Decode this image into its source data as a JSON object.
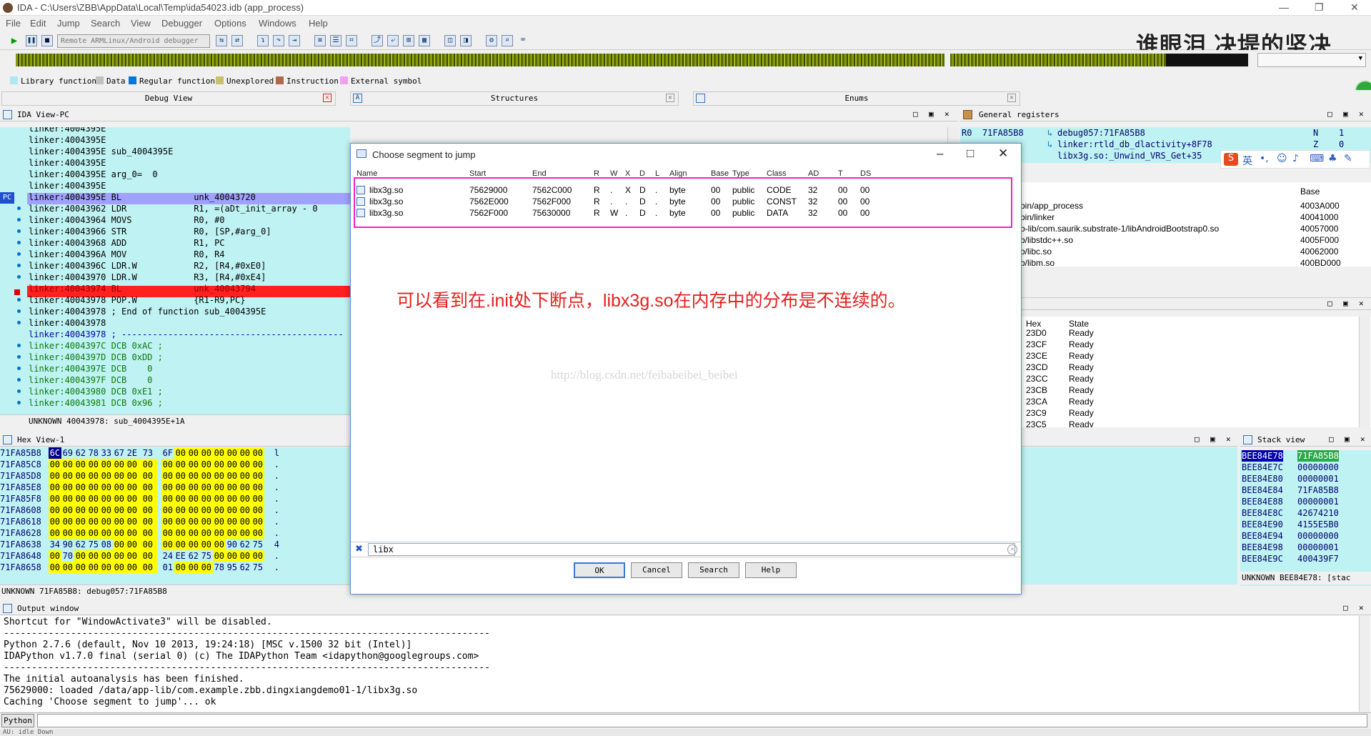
{
  "window": {
    "title": "IDA - C:\\Users\\ZBB\\AppData\\Local\\Temp\\ida54023.idb (app_process)"
  },
  "menu": [
    "File",
    "Edit",
    "Jump",
    "Search",
    "View",
    "Debugger",
    "Options",
    "Windows",
    "Help"
  ],
  "toolbar": {
    "debugger": "Remote ARMLinux/Android debugger"
  },
  "overlay_caption": "谁眼泪 决堤的坚决",
  "legend": [
    {
      "label": "Library function",
      "color": "#aee8f0"
    },
    {
      "label": "Data",
      "color": "#c0c0c0"
    },
    {
      "label": "Regular function",
      "color": "#0078d7"
    },
    {
      "label": "Unexplored",
      "color": "#c8c070"
    },
    {
      "label": "Instruction",
      "color": "#b06848"
    },
    {
      "label": "External symbol",
      "color": "#f0a0f0"
    }
  ],
  "tabs": {
    "debug_view": "Debug View",
    "structures": "Structures",
    "enums": "Enums"
  },
  "ida_view": {
    "title": "IDA View-PC",
    "lines": [
      "linker:4004395E",
      "linker:4004395E",
      "linker:4004395E sub_4004395E",
      "linker:4004395E",
      "linker:4004395E arg_0=  0",
      "linker:4004395E",
      "linker:4004395E BL              unk_40043720",
      "linker:40043962 LDR             R1, =(aDt_init_array - 0",
      "linker:40043964 MOVS            R0, #0",
      "linker:40043966 STR             R0, [SP,#arg_0]",
      "linker:40043968 ADD             R1, PC",
      "linker:4004396A MOV             R0, R4",
      "linker:4004396C LDR.W           R2, [R4,#0xE0]",
      "linker:40043970 LDR.W           R3, [R4,#0xE4]",
      "linker:40043974 BL              unk_40043794",
      "linker:40043978 POP.W           {R1-R9,PC}",
      "linker:40043978 ; End of function sub_4004395E",
      "linker:40043978",
      "linker:40043978 ; -------------------------------------------",
      "linker:4004397C DCB 0xAC ;",
      "linker:4004397D DCB 0xDD ;",
      "linker:4004397E DCB    0",
      "linker:4004397F DCB    0",
      "linker:40043980 DCB 0xE1 ;",
      "linker:40043981 DCB 0x96 ;"
    ],
    "pc_label": "PC",
    "status": "UNKNOWN 40043978: sub_4004395E+1A"
  },
  "hex_view": {
    "title": "Hex View-1",
    "rows": [
      {
        "addr": "71FA85B8",
        "bytes": [
          "6C",
          "69",
          "62",
          "78",
          "33",
          "67",
          "2E",
          "73",
          "6F",
          "00",
          "00",
          "00",
          "00",
          "00",
          "00",
          "00"
        ],
        "ascii": "l"
      },
      {
        "addr": "71FA85C8",
        "bytes": [
          "00",
          "00",
          "00",
          "00",
          "00",
          "00",
          "00",
          "00",
          "00",
          "00",
          "00",
          "00",
          "00",
          "00",
          "00",
          "00"
        ],
        "ascii": "."
      },
      {
        "addr": "71FA85D8",
        "bytes": [
          "00",
          "00",
          "00",
          "00",
          "00",
          "00",
          "00",
          "00",
          "00",
          "00",
          "00",
          "00",
          "00",
          "00",
          "00",
          "00"
        ],
        "ascii": "."
      },
      {
        "addr": "71FA85E8",
        "bytes": [
          "00",
          "00",
          "00",
          "00",
          "00",
          "00",
          "00",
          "00",
          "00",
          "00",
          "00",
          "00",
          "00",
          "00",
          "00",
          "00"
        ],
        "ascii": "."
      },
      {
        "addr": "71FA85F8",
        "bytes": [
          "00",
          "00",
          "00",
          "00",
          "00",
          "00",
          "00",
          "00",
          "00",
          "00",
          "00",
          "00",
          "00",
          "00",
          "00",
          "00"
        ],
        "ascii": "."
      },
      {
        "addr": "71FA8608",
        "bytes": [
          "00",
          "00",
          "00",
          "00",
          "00",
          "00",
          "00",
          "00",
          "00",
          "00",
          "00",
          "00",
          "00",
          "00",
          "00",
          "00"
        ],
        "ascii": "."
      },
      {
        "addr": "71FA8618",
        "bytes": [
          "00",
          "00",
          "00",
          "00",
          "00",
          "00",
          "00",
          "00",
          "00",
          "00",
          "00",
          "00",
          "00",
          "00",
          "00",
          "00"
        ],
        "ascii": "."
      },
      {
        "addr": "71FA8628",
        "bytes": [
          "00",
          "00",
          "00",
          "00",
          "00",
          "00",
          "00",
          "00",
          "00",
          "00",
          "00",
          "00",
          "00",
          "00",
          "00",
          "00"
        ],
        "ascii": "."
      },
      {
        "addr": "71FA8638",
        "bytes": [
          "34",
          "90",
          "62",
          "75",
          "08",
          "00",
          "00",
          "00",
          "00",
          "00",
          "00",
          "00",
          "00",
          "90",
          "62",
          "75"
        ],
        "ascii": "4"
      },
      {
        "addr": "71FA8648",
        "bytes": [
          "00",
          "70",
          "00",
          "00",
          "00",
          "00",
          "00",
          "00",
          "24",
          "EE",
          "62",
          "75",
          "00",
          "00",
          "00",
          "00"
        ],
        "ascii": "."
      },
      {
        "addr": "71FA8658",
        "bytes": [
          "00",
          "00",
          "00",
          "00",
          "00",
          "00",
          "00",
          "00",
          "01",
          "00",
          "00",
          "00",
          "78",
          "95",
          "62",
          "75"
        ],
        "ascii": "."
      }
    ],
    "status": "UNKNOWN 71FA85B8: debug057:71FA85B8"
  },
  "registers": {
    "title": "General registers",
    "r0": "R0  71FA85B8",
    "r0_ref": "debug057:71FA85B8",
    "r1_ref": "linker:rtld_db_dlactivity+8F78",
    "r2_ref": "libx3g.so:_Unwind_VRS_Get+35",
    "flags": [
      {
        "name": "N",
        "value": "1"
      },
      {
        "name": "Z",
        "value": "0"
      }
    ]
  },
  "modules": {
    "base_label": "Base",
    "rows": [
      {
        "path": "bin/app_process",
        "base": "4003A000"
      },
      {
        "path": "bin/linker",
        "base": "40041000"
      },
      {
        "path": "b-lib/com.saurik.substrate-1/libAndroidBootstrap0.so",
        "base": "40057000"
      },
      {
        "path": "b/libstdc++.so",
        "base": "4005F000"
      },
      {
        "path": "b/libc.so",
        "base": "40062000"
      },
      {
        "path": "b/libm.so",
        "base": "400BD000"
      }
    ]
  },
  "threads": {
    "hex_label": "Hex",
    "state_label": "State",
    "rows": [
      {
        "hex": "23D0",
        "state": "Ready"
      },
      {
        "hex": "23CF",
        "state": "Ready"
      },
      {
        "hex": "23CE",
        "state": "Ready"
      },
      {
        "hex": "23CD",
        "state": "Ready"
      },
      {
        "hex": "23CC",
        "state": "Ready"
      },
      {
        "hex": "23CB",
        "state": "Ready"
      },
      {
        "hex": "23CA",
        "state": "Ready"
      },
      {
        "hex": "23C9",
        "state": "Ready"
      },
      {
        "hex": "23C5",
        "state": "Ready"
      }
    ]
  },
  "stack_view": {
    "title": "Stack view",
    "rows": [
      {
        "addr": "BEE84E78",
        "val": "71FA85B8"
      },
      {
        "addr": "BEE84E7C",
        "val": "00000000"
      },
      {
        "addr": "BEE84E80",
        "val": "00000001"
      },
      {
        "addr": "BEE84E84",
        "val": "71FA85B8"
      },
      {
        "addr": "BEE84E88",
        "val": "00000001"
      },
      {
        "addr": "BEE84E8C",
        "val": "42674210"
      },
      {
        "addr": "BEE84E90",
        "val": "4155E5B0"
      },
      {
        "addr": "BEE84E94",
        "val": "00000000"
      },
      {
        "addr": "BEE84E98",
        "val": "00000001"
      },
      {
        "addr": "BEE84E9C",
        "val": "400439F7"
      }
    ],
    "status": "UNKNOWN BEE84E78: [stac"
  },
  "output": {
    "title": "Output window",
    "lines": [
      "Shortcut for \"WindowActivate3\" will be disabled.",
      "---------------------------------------------------------------------------------------",
      "Python 2.7.6 (default, Nov 10 2013, 19:24:18) [MSC v.1500 32 bit (Intel)]",
      "IDAPython v1.7.0 final (serial 0) (c) The IDAPython Team <idapython@googlegroups.com>",
      "---------------------------------------------------------------------------------------",
      "The initial autoanalysis has been finished.",
      "75629000: loaded /data/app-lib/com.example.zbb.dingxiangdemo01-1/libx3g.so",
      "Caching 'Choose segment to jump'... ok"
    ],
    "python_label": "Python",
    "status": "AU:  idle    Down"
  },
  "dialog": {
    "title": "Choose segment to jump",
    "columns": [
      "Name",
      "Start",
      "End",
      "R",
      "W",
      "X",
      "D",
      "L",
      "Align",
      "Base",
      "Type",
      "Class",
      "AD",
      "T",
      "DS"
    ],
    "rows": [
      [
        "libx3g.so",
        "75629000",
        "7562C000",
        "R",
        ".",
        "X",
        "D",
        ".",
        "byte",
        "00",
        "public",
        "CODE",
        "32",
        "00",
        "00"
      ],
      [
        "libx3g.so",
        "7562E000",
        "7562F000",
        "R",
        ".",
        ".",
        "D",
        ".",
        "byte",
        "00",
        "public",
        "CONST",
        "32",
        "00",
        "00"
      ],
      [
        "libx3g.so",
        "7562F000",
        "75630000",
        "R",
        "W",
        ".",
        "D",
        ".",
        "byte",
        "00",
        "public",
        "DATA",
        "32",
        "00",
        "00"
      ]
    ],
    "annotation": "可以看到在.init处下断点，libx3g.so在内存中的分布是不连续的。",
    "watermark": "http://blog.csdn.net/feibabeibei_beibei",
    "filter_value": "libx",
    "buttons": {
      "ok": "OK",
      "cancel": "Cancel",
      "search": "Search",
      "help": "Help"
    }
  },
  "ime": {
    "label": "英"
  }
}
